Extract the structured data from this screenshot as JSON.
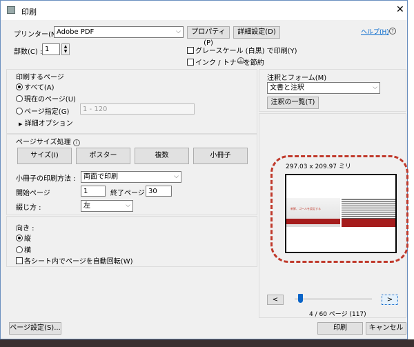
{
  "window": {
    "title": "印刷",
    "close": "✕"
  },
  "printer": {
    "label": "プリンター(N) :",
    "value": "Adobe PDF",
    "properties": "プロパティ(P)",
    "advanced": "詳細設定(D)",
    "help": "ヘルプ(H)"
  },
  "copies": {
    "label": "部数(C) :",
    "value": "1"
  },
  "options": {
    "grayscale": "グレースケール (白黒) で印刷(Y)",
    "save_ink": "インク / トナーを節約"
  },
  "pages": {
    "title": "印刷するページ",
    "all": "すべて(A)",
    "current": "現在のページ(U)",
    "range": "ページ指定(G)",
    "range_value": "1 - 120",
    "more": "詳細オプション"
  },
  "sizing": {
    "title": "ページサイズ処理",
    "buttons": [
      "サイズ(I)",
      "ポスター",
      "複数",
      "小冊子"
    ],
    "booklet_label": "小冊子の印刷方法 :",
    "booklet_value": "両面で印刷",
    "start_label": "開始ページ",
    "start_value": "1",
    "end_label": "終了ページ",
    "end_value": "30",
    "binding_label": "綴じ方 :",
    "binding_value": "左"
  },
  "orientation": {
    "title": "向き :",
    "portrait": "縦",
    "landscape": "横",
    "auto_rotate": "各シート内でページを自動回転(W)"
  },
  "annotations": {
    "title": "注釈とフォーム(M)",
    "value": "文書と注釈",
    "summary": "注釈の一覧(T)"
  },
  "preview": {
    "size": "297.03 x 209.97 ミリ",
    "slide_text": "新鮮、ゴールを設定する",
    "prev": "<",
    "next": ">",
    "page_info": "4 / 60 ページ (117)",
    "current_page": 4,
    "total_pages": 60
  },
  "footer": {
    "page_setup": "ページ設定(S)...",
    "print": "印刷",
    "cancel": "キャンセル"
  },
  "colors": {
    "accent": "#c0392b",
    "link": "#0066cc",
    "slider": "#0a64c8"
  }
}
